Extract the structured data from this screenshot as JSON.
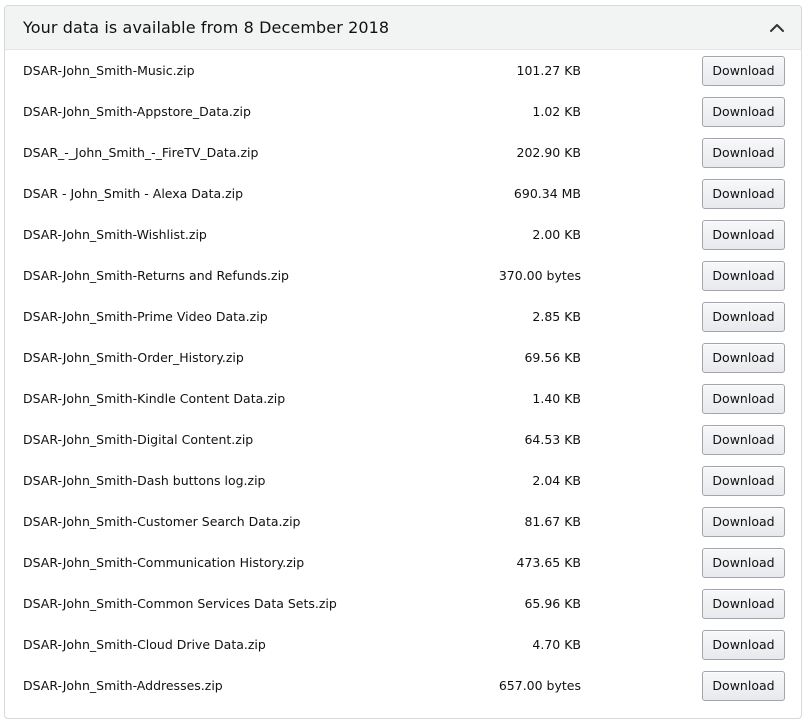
{
  "header": {
    "title": "Your data is available from 8 December 2018",
    "toggle_icon": "chevron-up-icon"
  },
  "download_label": "Download",
  "files": [
    {
      "name": "DSAR-John_Smith-Music.zip",
      "size": "101.27 KB"
    },
    {
      "name": "DSAR-John_Smith-Appstore_Data.zip",
      "size": "1.02 KB"
    },
    {
      "name": "DSAR_-_John_Smith_-_FireTV_Data.zip",
      "size": "202.90 KB"
    },
    {
      "name": "DSAR - John_Smith - Alexa Data.zip",
      "size": "690.34 MB"
    },
    {
      "name": "DSAR-John_Smith-Wishlist.zip",
      "size": "2.00 KB"
    },
    {
      "name": "DSAR-John_Smith-Returns and Refunds.zip",
      "size": "370.00 bytes"
    },
    {
      "name": "DSAR-John_Smith-Prime Video Data.zip",
      "size": "2.85 KB"
    },
    {
      "name": "DSAR-John_Smith-Order_History.zip",
      "size": "69.56 KB"
    },
    {
      "name": "DSAR-John_Smith-Kindle Content Data.zip",
      "size": "1.40 KB"
    },
    {
      "name": "DSAR-John_Smith-Digital Content.zip",
      "size": "64.53 KB"
    },
    {
      "name": "DSAR-John_Smith-Dash buttons log.zip",
      "size": "2.04 KB"
    },
    {
      "name": "DSAR-John_Smith-Customer Search Data.zip",
      "size": "81.67 KB"
    },
    {
      "name": "DSAR-John_Smith-Communication History.zip",
      "size": "473.65 KB"
    },
    {
      "name": "DSAR-John_Smith-Common Services Data Sets.zip",
      "size": "65.96 KB"
    },
    {
      "name": "DSAR-John_Smith-Cloud Drive Data.zip",
      "size": "4.70 KB"
    },
    {
      "name": "DSAR-John_Smith-Addresses.zip",
      "size": "657.00 bytes"
    }
  ],
  "colors": {
    "header_bg": "#f2f3f3",
    "border": "#d5d9d9",
    "button_border": "#a2a6ac"
  }
}
